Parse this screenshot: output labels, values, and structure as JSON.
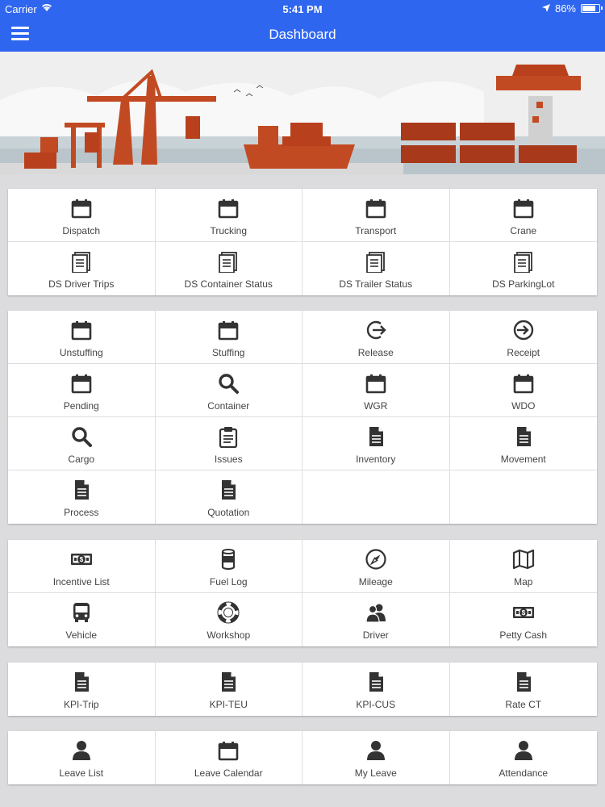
{
  "status_bar": {
    "carrier": "Carrier",
    "time": "5:41 PM",
    "battery_text": "86%",
    "battery_level": 0.86
  },
  "nav": {
    "title": "Dashboard"
  },
  "sections": [
    {
      "items": [
        {
          "label": "Dispatch",
          "icon": "calendar-icon"
        },
        {
          "label": "Trucking",
          "icon": "calendar-icon"
        },
        {
          "label": "Transport",
          "icon": "calendar-icon"
        },
        {
          "label": "Crane",
          "icon": "calendar-icon"
        },
        {
          "label": "DS Driver Trips",
          "icon": "list-document-icon"
        },
        {
          "label": "DS Container Status",
          "icon": "list-document-icon"
        },
        {
          "label": "DS Trailer Status",
          "icon": "list-document-icon"
        },
        {
          "label": "DS ParkingLot",
          "icon": "list-document-icon"
        }
      ]
    },
    {
      "items": [
        {
          "label": "Unstuffing",
          "icon": "calendar-icon"
        },
        {
          "label": "Stuffing",
          "icon": "calendar-icon"
        },
        {
          "label": "Release",
          "icon": "sign-out-icon"
        },
        {
          "label": "Receipt",
          "icon": "sign-in-icon"
        },
        {
          "label": "Pending",
          "icon": "calendar-icon"
        },
        {
          "label": "Container",
          "icon": "search-icon"
        },
        {
          "label": "WGR",
          "icon": "calendar-icon"
        },
        {
          "label": "WDO",
          "icon": "calendar-icon"
        },
        {
          "label": "Cargo",
          "icon": "search-icon"
        },
        {
          "label": "Issues",
          "icon": "clipboard-icon"
        },
        {
          "label": "Inventory",
          "icon": "document-icon"
        },
        {
          "label": "Movement",
          "icon": "document-icon"
        },
        {
          "label": "Process",
          "icon": "document-icon"
        },
        {
          "label": "Quotation",
          "icon": "document-icon"
        }
      ]
    },
    {
      "items": [
        {
          "label": "Incentive List",
          "icon": "money-icon"
        },
        {
          "label": "Fuel Log",
          "icon": "fuel-barrel-icon"
        },
        {
          "label": "Mileage",
          "icon": "compass-icon"
        },
        {
          "label": "Map",
          "icon": "map-icon"
        },
        {
          "label": "Vehicle",
          "icon": "bus-icon"
        },
        {
          "label": "Workshop",
          "icon": "lifebuoy-icon"
        },
        {
          "label": "Driver",
          "icon": "users-icon"
        },
        {
          "label": "Petty Cash",
          "icon": "money-icon"
        }
      ]
    },
    {
      "items": [
        {
          "label": "KPI-Trip",
          "icon": "document-icon"
        },
        {
          "label": "KPI-TEU",
          "icon": "document-icon"
        },
        {
          "label": "KPI-CUS",
          "icon": "document-icon"
        },
        {
          "label": "Rate CT",
          "icon": "document-icon"
        }
      ]
    },
    {
      "items": [
        {
          "label": "Leave List",
          "icon": "user-icon"
        },
        {
          "label": "Leave Calendar",
          "icon": "calendar-icon"
        },
        {
          "label": "My Leave",
          "icon": "user-icon"
        },
        {
          "label": "Attendance",
          "icon": "user-icon"
        }
      ]
    }
  ]
}
